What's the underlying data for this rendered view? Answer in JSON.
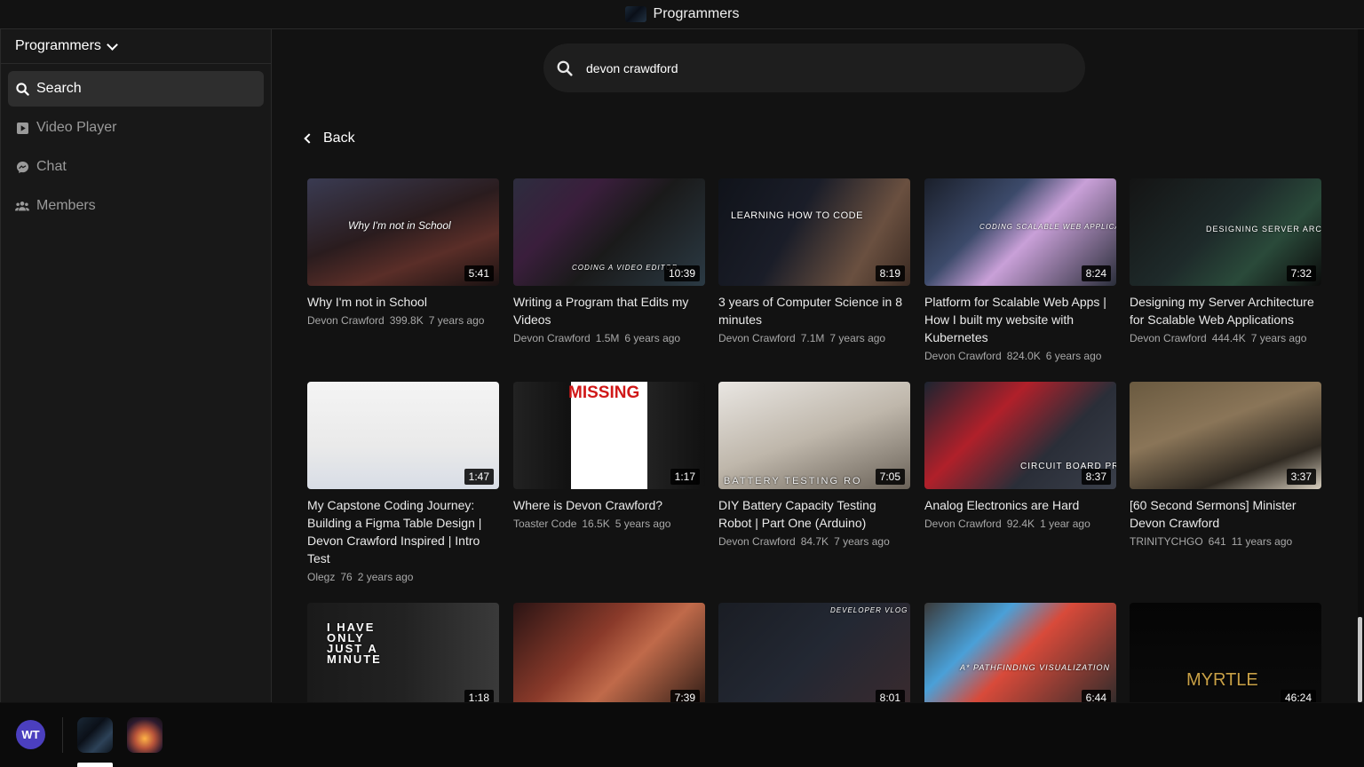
{
  "topbar": {
    "title": "Programmers"
  },
  "sidebar": {
    "group_name": "Programmers",
    "items": [
      {
        "label": "Search",
        "icon": "search-icon",
        "active": true
      },
      {
        "label": "Video Player",
        "icon": "play-icon",
        "active": false
      },
      {
        "label": "Chat",
        "icon": "messenger-icon",
        "active": false
      },
      {
        "label": "Members",
        "icon": "people-icon",
        "active": false
      }
    ]
  },
  "search": {
    "query": "devon crawdford"
  },
  "back_label": "Back",
  "videos": [
    {
      "title": "Why I'm not in School",
      "channel": "Devon Crawford",
      "views": "399.8K",
      "age": "7 years ago",
      "duration": "5:41",
      "overlay": "Why I'm not in School"
    },
    {
      "title": "Writing a Program that Edits my Videos",
      "channel": "Devon Crawford",
      "views": "1.5M",
      "age": "6 years ago",
      "duration": "10:39",
      "overlay": "CODING A VIDEO EDITOR"
    },
    {
      "title": "3 years of Computer Science in 8 minutes",
      "channel": "Devon Crawford",
      "views": "7.1M",
      "age": "7 years ago",
      "duration": "8:19",
      "overlay": "LEARNING HOW TO CODE"
    },
    {
      "title": "Platform for Scalable Web Apps | How I built my website with Kubernetes",
      "channel": "Devon Crawford",
      "views": "824.0K",
      "age": "6 years ago",
      "duration": "8:24",
      "overlay": "CODING SCALABLE WEB APPLICATIONS"
    },
    {
      "title": "Designing my Server Architecture for Scalable Web Applications",
      "channel": "Devon Crawford",
      "views": "444.4K",
      "age": "7 years ago",
      "duration": "7:32",
      "overlay": "DESIGNING SERVER ARCHITECTURE"
    },
    {
      "title": "My Capstone Coding Journey: Building a Figma Table Design | Devon Crawford Inspired | Intro Test",
      "channel": "Olegz",
      "views": "76",
      "age": "2 years ago",
      "duration": "1:47",
      "overlay": ""
    },
    {
      "title": "Where is Devon Crawford?",
      "channel": "Toaster Code",
      "views": "16.5K",
      "age": "5 years ago",
      "duration": "1:17",
      "overlay": "MISSING"
    },
    {
      "title": "DIY Battery Capacity Testing Robot | Part One (Arduino)",
      "channel": "Devon Crawford",
      "views": "84.7K",
      "age": "7 years ago",
      "duration": "7:05",
      "overlay": "BATTERY TESTING RO"
    },
    {
      "title": "Analog Electronics are Hard",
      "channel": "Devon Crawford",
      "views": "92.4K",
      "age": "1 year ago",
      "duration": "8:37",
      "overlay": "CIRCUIT BOARD PROTOTYPE"
    },
    {
      "title": "[60 Second Sermons] Minister Devon Crawford",
      "channel": "TRINITYCHGO",
      "views": "641",
      "age": "11 years ago",
      "duration": "3:37",
      "overlay": ""
    },
    {
      "title": "",
      "channel": "",
      "views": "",
      "age": "",
      "duration": "1:18",
      "overlay": "I HAVE ONLY JUST A MINUTE"
    },
    {
      "title": "",
      "channel": "",
      "views": "",
      "age": "",
      "duration": "7:39",
      "overlay": ""
    },
    {
      "title": "",
      "channel": "",
      "views": "",
      "age": "",
      "duration": "8:01",
      "overlay": "DEVELOPER VLOG"
    },
    {
      "title": "",
      "channel": "",
      "views": "",
      "age": "",
      "duration": "6:44",
      "overlay": "A* PATHFINDING VISUALIZATION"
    },
    {
      "title": "",
      "channel": "",
      "views": "",
      "age": "",
      "duration": "46:24",
      "overlay": "MYRTLE"
    }
  ],
  "bottombar": {
    "app_logo": "WT"
  }
}
